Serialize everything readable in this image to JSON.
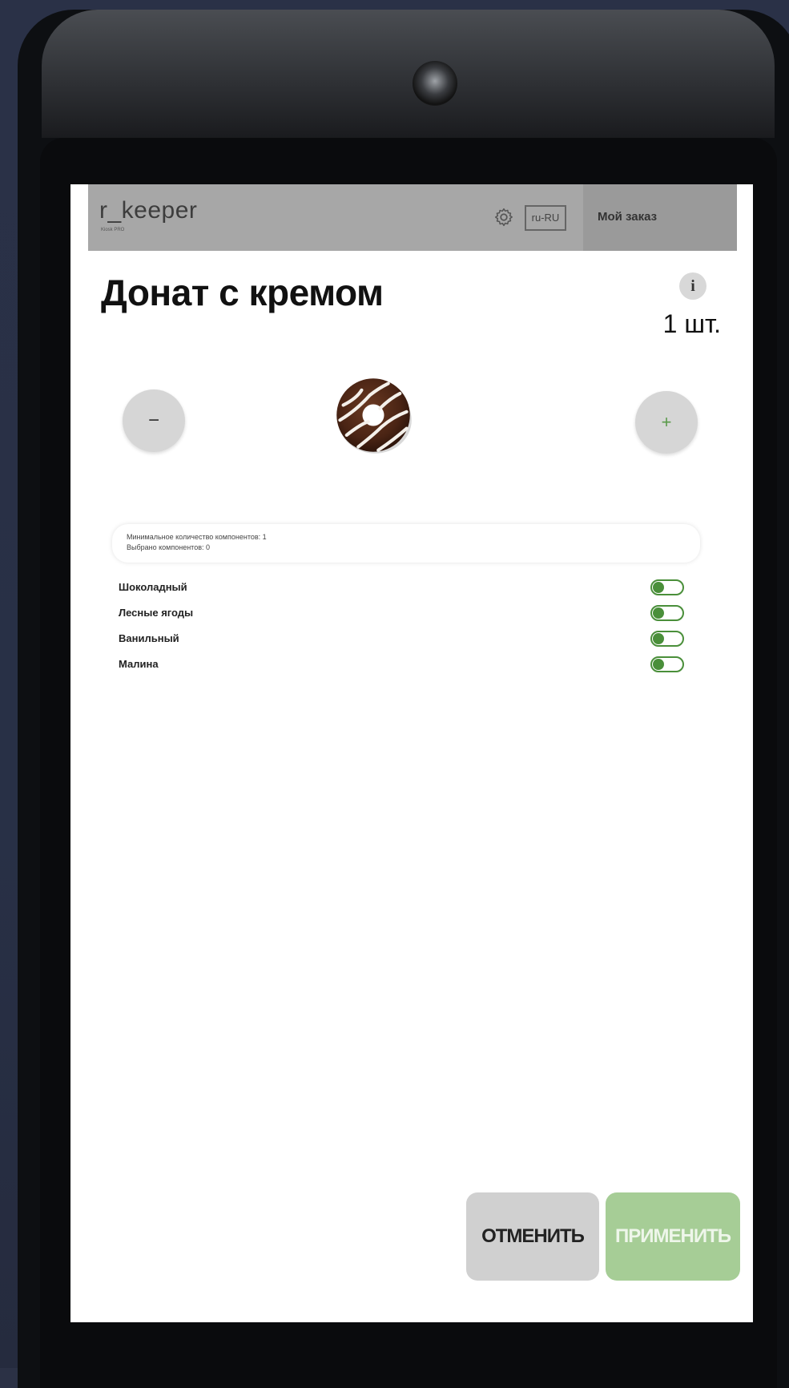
{
  "header": {
    "logo": "r_keeper",
    "logo_sub": "Kiosk PRO",
    "language": "ru-RU",
    "my_order": "Мой заказ"
  },
  "product": {
    "title": "Донат с кремом",
    "quantity": "1 шт.",
    "minus_label": "−",
    "plus_label": "+"
  },
  "constraints": {
    "min_line": "Минимальное количество компонентов: 1",
    "selected_line": "Выбрано компонентов: 0"
  },
  "options": [
    {
      "label": "Шоколадный",
      "enabled": false
    },
    {
      "label": "Лесные ягоды",
      "enabled": false
    },
    {
      "label": "Ванильный",
      "enabled": false
    },
    {
      "label": "Малина",
      "enabled": false
    }
  ],
  "actions": {
    "cancel": "ОТМЕНИТЬ",
    "apply": "ПРИМЕНИТЬ"
  },
  "colors": {
    "accent_green": "#4a8f3a",
    "apply_button": "#a6cd96",
    "cancel_button": "#d0d0d0",
    "topbar": "#a7a7a7"
  },
  "icons": [
    "gear-icon",
    "info-icon",
    "donut-image"
  ]
}
